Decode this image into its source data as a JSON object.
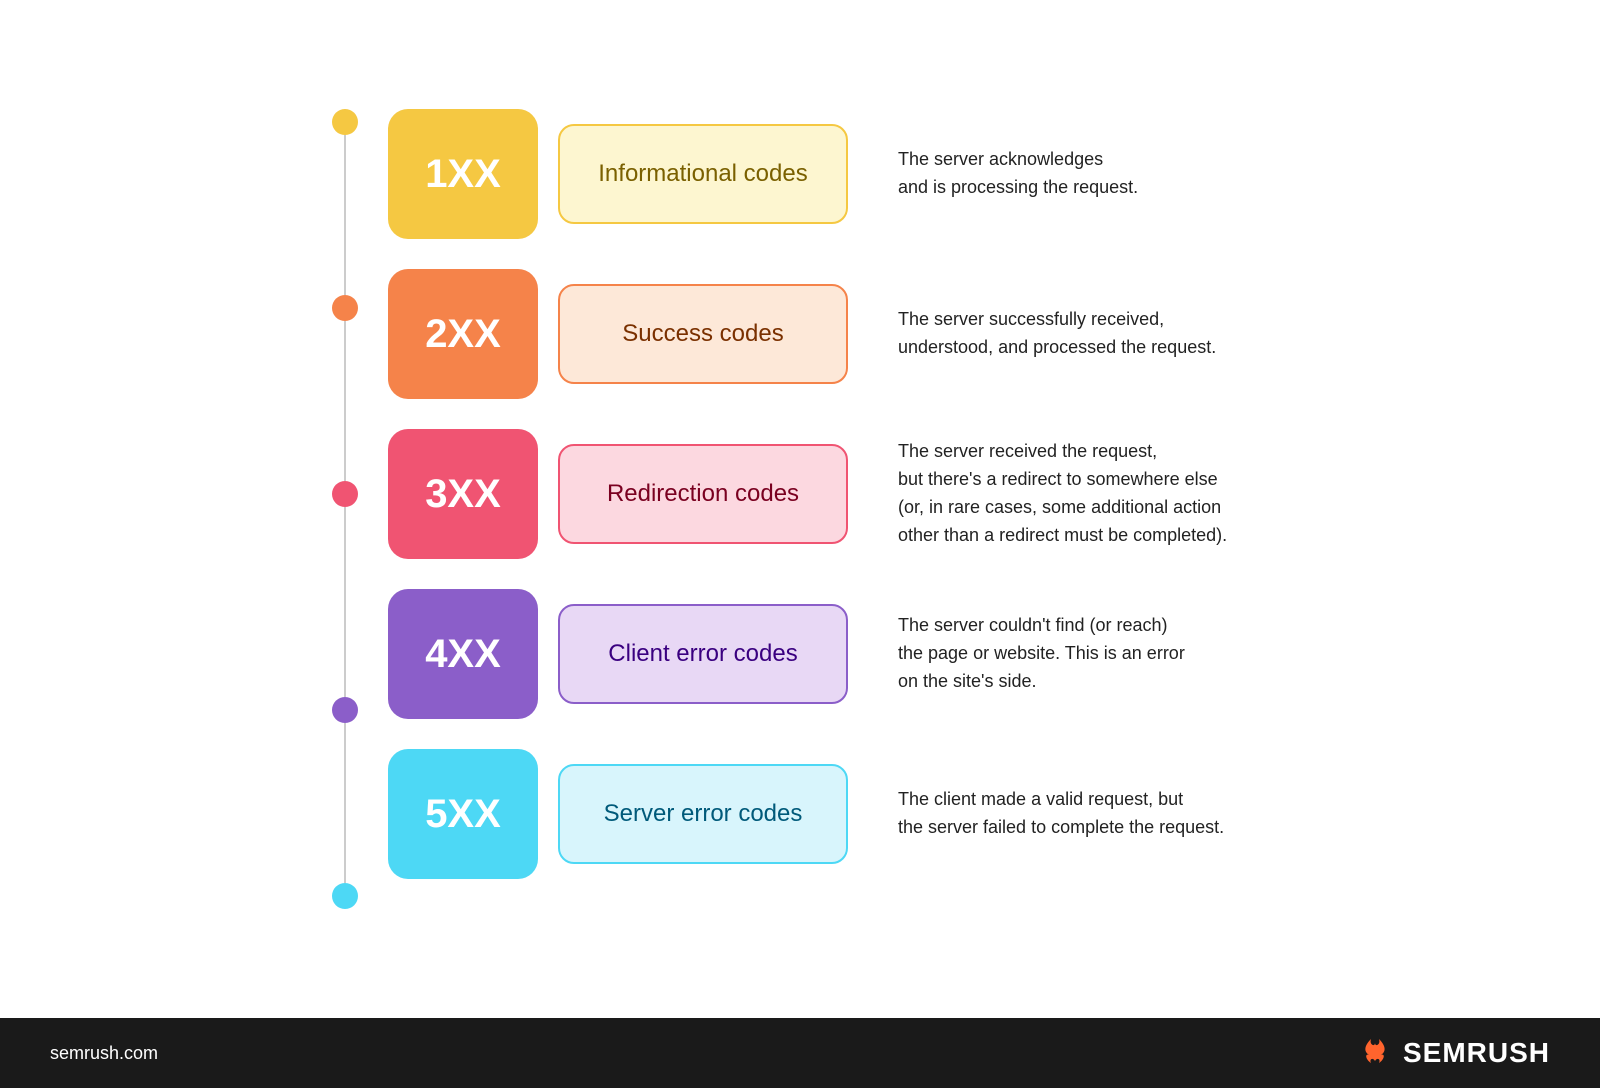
{
  "rows": [
    {
      "id": "1xx",
      "code": "1XX",
      "label": "Informational codes",
      "description": "The server acknowledges\nand is processing the request.",
      "dot_color": "#f5c842",
      "code_bg": "#f5c842",
      "label_bg": "#fdf6d0",
      "label_border": "#f5c842",
      "label_color": "#7a6000"
    },
    {
      "id": "2xx",
      "code": "2XX",
      "label": "Success codes",
      "description": "The server successfully received,\nunderstood, and processed the request.",
      "dot_color": "#f5834a",
      "code_bg": "#f5834a",
      "label_bg": "#fde8d8",
      "label_border": "#f5834a",
      "label_color": "#7a3000"
    },
    {
      "id": "3xx",
      "code": "3XX",
      "label": "Redirection codes",
      "description": "The server received the request,\nbut there's a redirect to somewhere else\n(or, in rare cases, some additional action\nother than a redirect must be completed).",
      "dot_color": "#f05472",
      "code_bg": "#f05472",
      "label_bg": "#fcd8e0",
      "label_border": "#f05472",
      "label_color": "#7a0020"
    },
    {
      "id": "4xx",
      "code": "4XX",
      "label": "Client error codes",
      "description": "The server couldn't find (or reach)\nthe page or website. This is an error\non the site's side.",
      "dot_color": "#8b5ec9",
      "code_bg": "#8b5ec9",
      "label_bg": "#e8d8f5",
      "label_border": "#8b5ec9",
      "label_color": "#3a0080"
    },
    {
      "id": "5xx",
      "code": "5XX",
      "label": "Server error codes",
      "description": "The client made a valid request, but\nthe server failed to complete the request.",
      "dot_color": "#4dd8f5",
      "code_bg": "#4dd8f5",
      "label_bg": "#d8f5fc",
      "label_border": "#4dd8f5",
      "label_color": "#005a7a"
    }
  ],
  "footer": {
    "url": "semrush.com",
    "brand": "SEMRUSH"
  }
}
